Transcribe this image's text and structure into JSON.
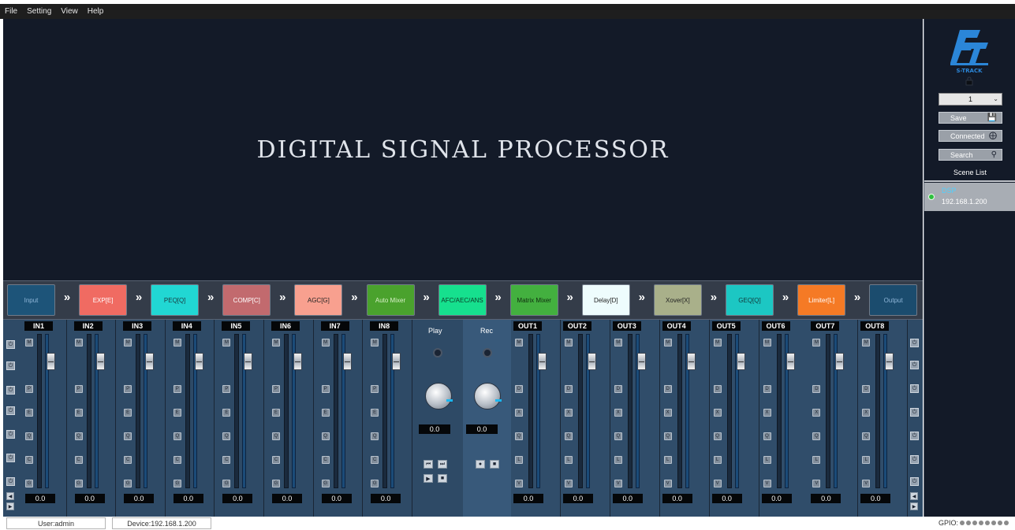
{
  "menu": [
    "File",
    "Setting",
    "View",
    "Help"
  ],
  "banner": {
    "title": "DIGITAL SIGNAL PROCESSOR"
  },
  "right_panel": {
    "logo_text": "S-TRACK",
    "scene_select": "1",
    "buttons": [
      {
        "label": "Save",
        "icon": "save-icon"
      },
      {
        "label": "Connected",
        "icon": "connect-icon"
      },
      {
        "label": "Search",
        "icon": "search-icon"
      }
    ],
    "scene_list_label": "Scene List",
    "device": {
      "name": "DSP",
      "ip": "192.168.1.200",
      "status_color": "#2fbf3f"
    }
  },
  "chain": [
    {
      "label": "Input",
      "color": "#1d5479",
      "text_color": "#8fb6d8"
    },
    {
      "label": "EXP[E]",
      "color": "#f06b62",
      "text_color": "#ffffff"
    },
    {
      "label": "PEQ[Q]",
      "color": "#21d7d3",
      "text_color": "#1a3a40"
    },
    {
      "label": "COMP[C]",
      "color": "#c26a6e",
      "text_color": "#ffffff"
    },
    {
      "label": "AGC[G]",
      "color": "#f8a08f",
      "text_color": "#222222"
    },
    {
      "label": "Auto Mixer",
      "color": "#4aa22d",
      "text_color": "#d8f0c8"
    },
    {
      "label": "AFC/AEC/ANS",
      "color": "#16e08e",
      "text_color": "#0a3a26"
    },
    {
      "label": "Matrix Mixer",
      "color": "#43b03f",
      "text_color": "#0f2a0f"
    },
    {
      "label": "Delay[D]",
      "color": "#eefcfd",
      "text_color": "#222222"
    },
    {
      "label": "Xover[X]",
      "color": "#a9b08a",
      "text_color": "#222222"
    },
    {
      "label": "GEQ[Q]",
      "color": "#1cc7c3",
      "text_color": "#123a3c"
    },
    {
      "label": "Limiter[L]",
      "color": "#f57a25",
      "text_color": "#ffffff"
    },
    {
      "label": "Output",
      "color": "#1b4c6e",
      "text_color": "#8fb6d8"
    }
  ],
  "inputs": [
    {
      "name": "IN1",
      "value": "0.0"
    },
    {
      "name": "IN2",
      "value": "0.0"
    },
    {
      "name": "IN3",
      "value": "0.0"
    },
    {
      "name": "IN4",
      "value": "0.0"
    },
    {
      "name": "IN5",
      "value": "0.0"
    },
    {
      "name": "IN6",
      "value": "0.0"
    },
    {
      "name": "IN7",
      "value": "0.0"
    },
    {
      "name": "IN8",
      "value": "0.0"
    }
  ],
  "input_buttons": [
    "M",
    "P",
    "E",
    "Q",
    "C",
    "G"
  ],
  "outputs": [
    {
      "name": "OUT1",
      "value": "0.0"
    },
    {
      "name": "OUT2",
      "value": "0.0"
    },
    {
      "name": "OUT3",
      "value": "0.0"
    },
    {
      "name": "OUT4",
      "value": "0.0"
    },
    {
      "name": "OUT5",
      "value": "0.0"
    },
    {
      "name": "OUT6",
      "value": "0.0"
    },
    {
      "name": "OUT7",
      "value": "0.0"
    },
    {
      "name": "OUT8",
      "value": "0.0"
    }
  ],
  "output_buttons": [
    "M",
    "D",
    "X",
    "Q",
    "L",
    "V"
  ],
  "play": {
    "label": "Play",
    "value": "0.0"
  },
  "rec": {
    "label": "Rec",
    "value": "0.0"
  },
  "status": {
    "user": "User:admin",
    "device": "Device:192.168.1.200",
    "gpio_label": "GPIO:",
    "gpio_count": 8
  }
}
